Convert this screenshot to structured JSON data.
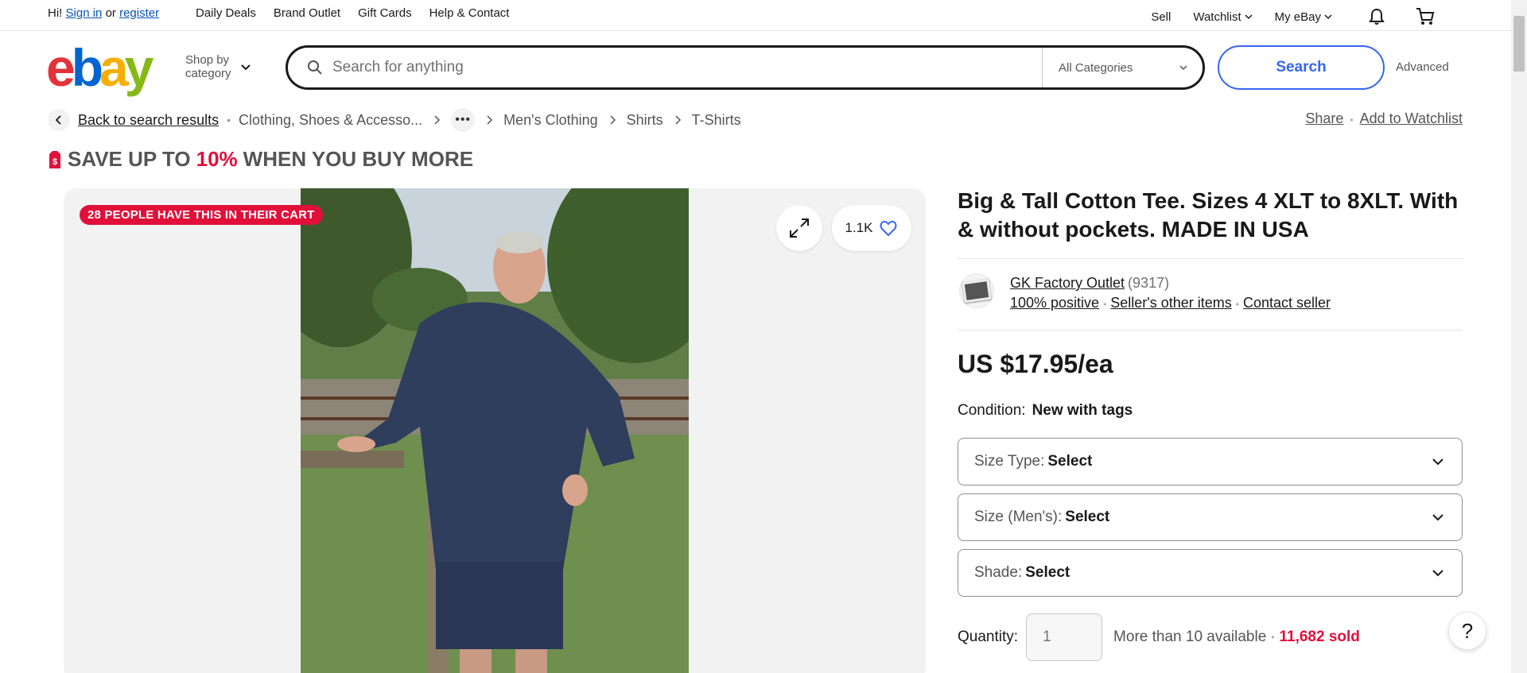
{
  "topbar": {
    "greeting": "Hi!",
    "sign_in": "Sign in",
    "or": "or",
    "register": "register",
    "links": [
      "Daily Deals",
      "Brand Outlet",
      "Gift Cards",
      "Help & Contact"
    ],
    "sell": "Sell",
    "watchlist": "Watchlist",
    "my_ebay": "My eBay"
  },
  "header": {
    "logo": [
      "e",
      "b",
      "a",
      "y"
    ],
    "shop_by_line1": "Shop by",
    "shop_by_line2": "category",
    "search_placeholder": "Search for anything",
    "category": "All Categories",
    "search_button": "Search",
    "advanced": "Advanced"
  },
  "breadcrumb": {
    "back": "Back to search results",
    "items": [
      "Clothing, Shoes & Accesso...",
      "Men's Clothing",
      "Shirts",
      "T-Shirts"
    ],
    "more": "•••",
    "share": "Share",
    "add_watchlist": "Add to Watchlist"
  },
  "promo": {
    "pre": "SAVE UP TO",
    "pct": "10%",
    "post": "WHEN YOU BUY MORE"
  },
  "gallery": {
    "cart_badge": "28 PEOPLE HAVE THIS IN THEIR CART",
    "watchers": "1.1K"
  },
  "item": {
    "title": "Big & Tall Cotton Tee. Sizes 4 XLT to 8XLT. With & without pockets. MADE IN USA",
    "seller_name": "GK Factory Outlet",
    "seller_count": "(9317)",
    "positive": "100% positive",
    "other_items": "Seller's other items",
    "contact": "Contact seller",
    "price": "US $17.95/ea",
    "condition_label": "Condition:",
    "condition_value": "New with tags",
    "selects": [
      {
        "label": "Size Type:",
        "value": "Select"
      },
      {
        "label": "Size (Men's):",
        "value": "Select"
      },
      {
        "label": "Shade:",
        "value": "Select"
      }
    ],
    "quantity_label": "Quantity:",
    "quantity_placeholder": "1",
    "available": "More than 10 available",
    "sold": "11,682 sold"
  },
  "help": "?",
  "colors": {
    "ebay_red": "#e53238",
    "ebay_blue": "#0064d2",
    "ebay_yellow": "#f5af02",
    "ebay_green": "#86b817",
    "accent_blue": "#3665f3",
    "alert_red": "#e0103a"
  },
  "icons": [
    "chevron-down-icon",
    "bell-icon",
    "cart-icon",
    "search-icon",
    "back-arrow-icon",
    "chevron-right-icon",
    "tag-icon",
    "expand-icon",
    "heart-icon",
    "help-icon"
  ]
}
